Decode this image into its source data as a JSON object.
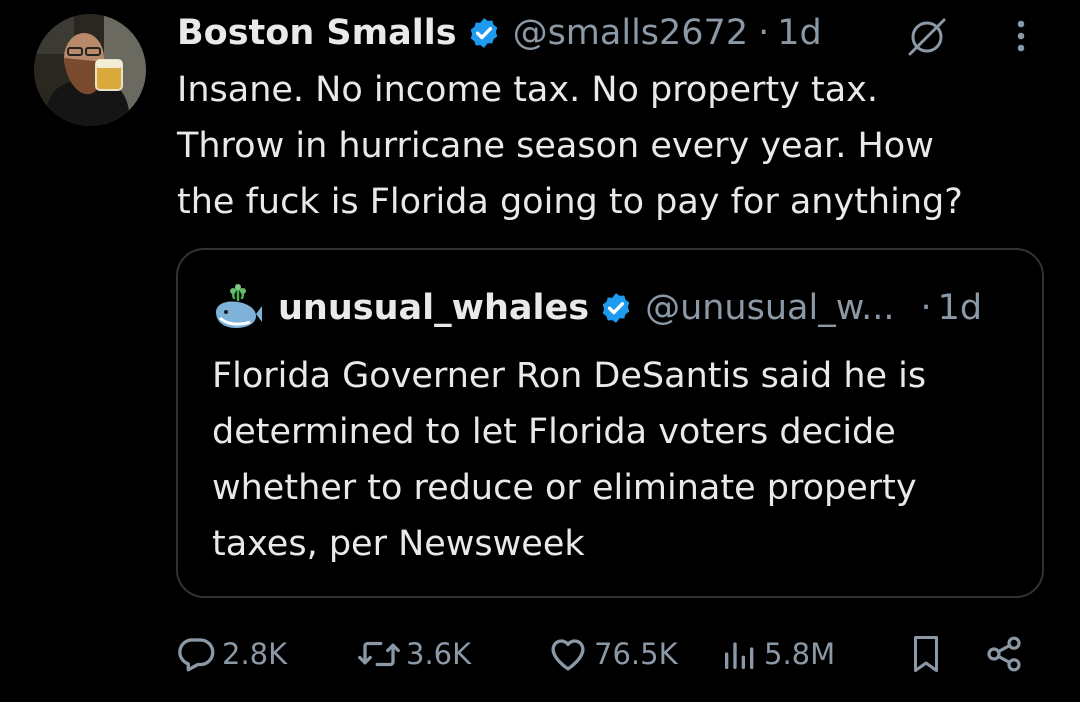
{
  "tweet": {
    "author": {
      "display_name": "Boston Smalls",
      "handle": "@smalls2672",
      "verified": true,
      "time": "1d"
    },
    "text": "Insane. No income tax. No property tax.\nThrow in hurricane season every year. How\nthe fuck is Florida going to pay for anything?",
    "header_icons": [
      "grok-icon",
      "more-options-icon"
    ]
  },
  "quote": {
    "author": {
      "display_name": "unusual_whales",
      "handle": "@unusual_w...",
      "verified": true,
      "time": "1d",
      "avatar_icon": "whale-icon"
    },
    "text": "Florida Governer Ron DeSantis said he is\ndetermined to let Florida voters decide\nwhether to reduce or eliminate property\ntaxes, per Newsweek"
  },
  "actions": {
    "replies": "2.8K",
    "reposts": "3.6K",
    "likes": "76.5K",
    "views": "5.8M",
    "bookmark_icon": "bookmark-icon",
    "share_icon": "share-icon"
  },
  "separator": "·",
  "colors": {
    "background": "#000000",
    "text_primary": "#e7e9ea",
    "text_secondary": "#8b98a5",
    "verified_blue": "#1d9bf0",
    "border": "#2f3336"
  }
}
